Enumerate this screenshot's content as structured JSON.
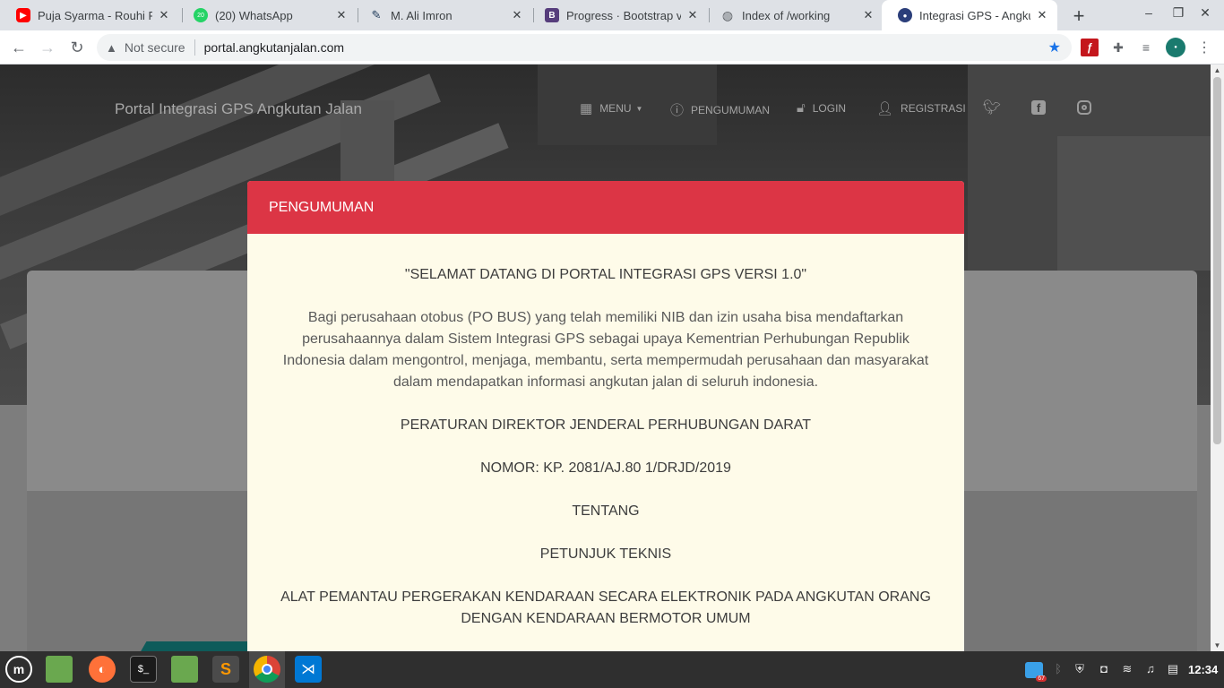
{
  "browser": {
    "tabs": [
      {
        "title": "Puja Syarma - Rouhi Fi",
        "icon": "youtube-icon"
      },
      {
        "title": "(20) WhatsApp",
        "icon": "whatsapp-icon",
        "badge": "20"
      },
      {
        "title": "M. Ali Imron",
        "icon": "page-icon"
      },
      {
        "title": "Progress · Bootstrap v",
        "icon": "bootstrap-icon",
        "badge": "B"
      },
      {
        "title": "Index of /working",
        "icon": "globe-icon"
      },
      {
        "title": "Integrasi GPS - Angkut",
        "icon": "site-logo-icon",
        "active": true
      }
    ],
    "security_label": "Not secure",
    "url": "portal.angkutanjalan.com",
    "bookmarked": true
  },
  "site": {
    "title": "Portal Integrasi GPS Angkutan Jalan",
    "nav": {
      "menu": "MENU",
      "announcement": "PENGUMUMAN",
      "login": "LOGIN",
      "register": "REGISTRASI"
    },
    "social": [
      "twitter-icon",
      "facebook-icon",
      "instagram-icon"
    ]
  },
  "modal": {
    "header": "PENGUMUMAN",
    "welcome": "\"SELAMAT DATANG DI PORTAL INTEGRASI GPS VERSI 1.0\"",
    "description": "Bagi perusahaan otobus (PO BUS) yang telah memiliki NIB dan izin usaha bisa mendaftarkan perusahaannya dalam Sistem Integrasi GPS sebagai upaya Kementrian Perhubungan Republik Indonesia dalam mengontrol, menjaga, membantu, serta mempermudah perusahaan dan masyarakat dalam mendapatkan informasi angkutan jalan di seluruh indonesia.",
    "regulation": "PERATURAN DIREKTOR JENDERAL PERHUBUNGAN DARAT",
    "number": "NOMOR: KP. 2081/AJ.80 1/DRJD/2019",
    "about": "TENTANG",
    "guide": "PETUNJUK TEKNIS",
    "subject": "ALAT PEMANTAU PERGERAKAN KENDARAAN SECARA ELEKTRONIK PADA ANGKUTAN ORANG DENGAN KENDARAAN BERMOTOR UMUM"
  },
  "taskbar": {
    "apps": [
      "mint-menu-icon",
      "files-icon",
      "firefox-icon",
      "terminal-icon",
      "folder-icon",
      "sublime-icon",
      "chrome-icon",
      "vscode-icon"
    ],
    "terminal_glyph": "$_",
    "sublime_glyph": "S",
    "update_badge": "67",
    "clock": "12:34"
  },
  "colors": {
    "modal_header": "#dc3545",
    "modal_body": "#fefbe9",
    "taskbar": "#2f2f2f"
  }
}
